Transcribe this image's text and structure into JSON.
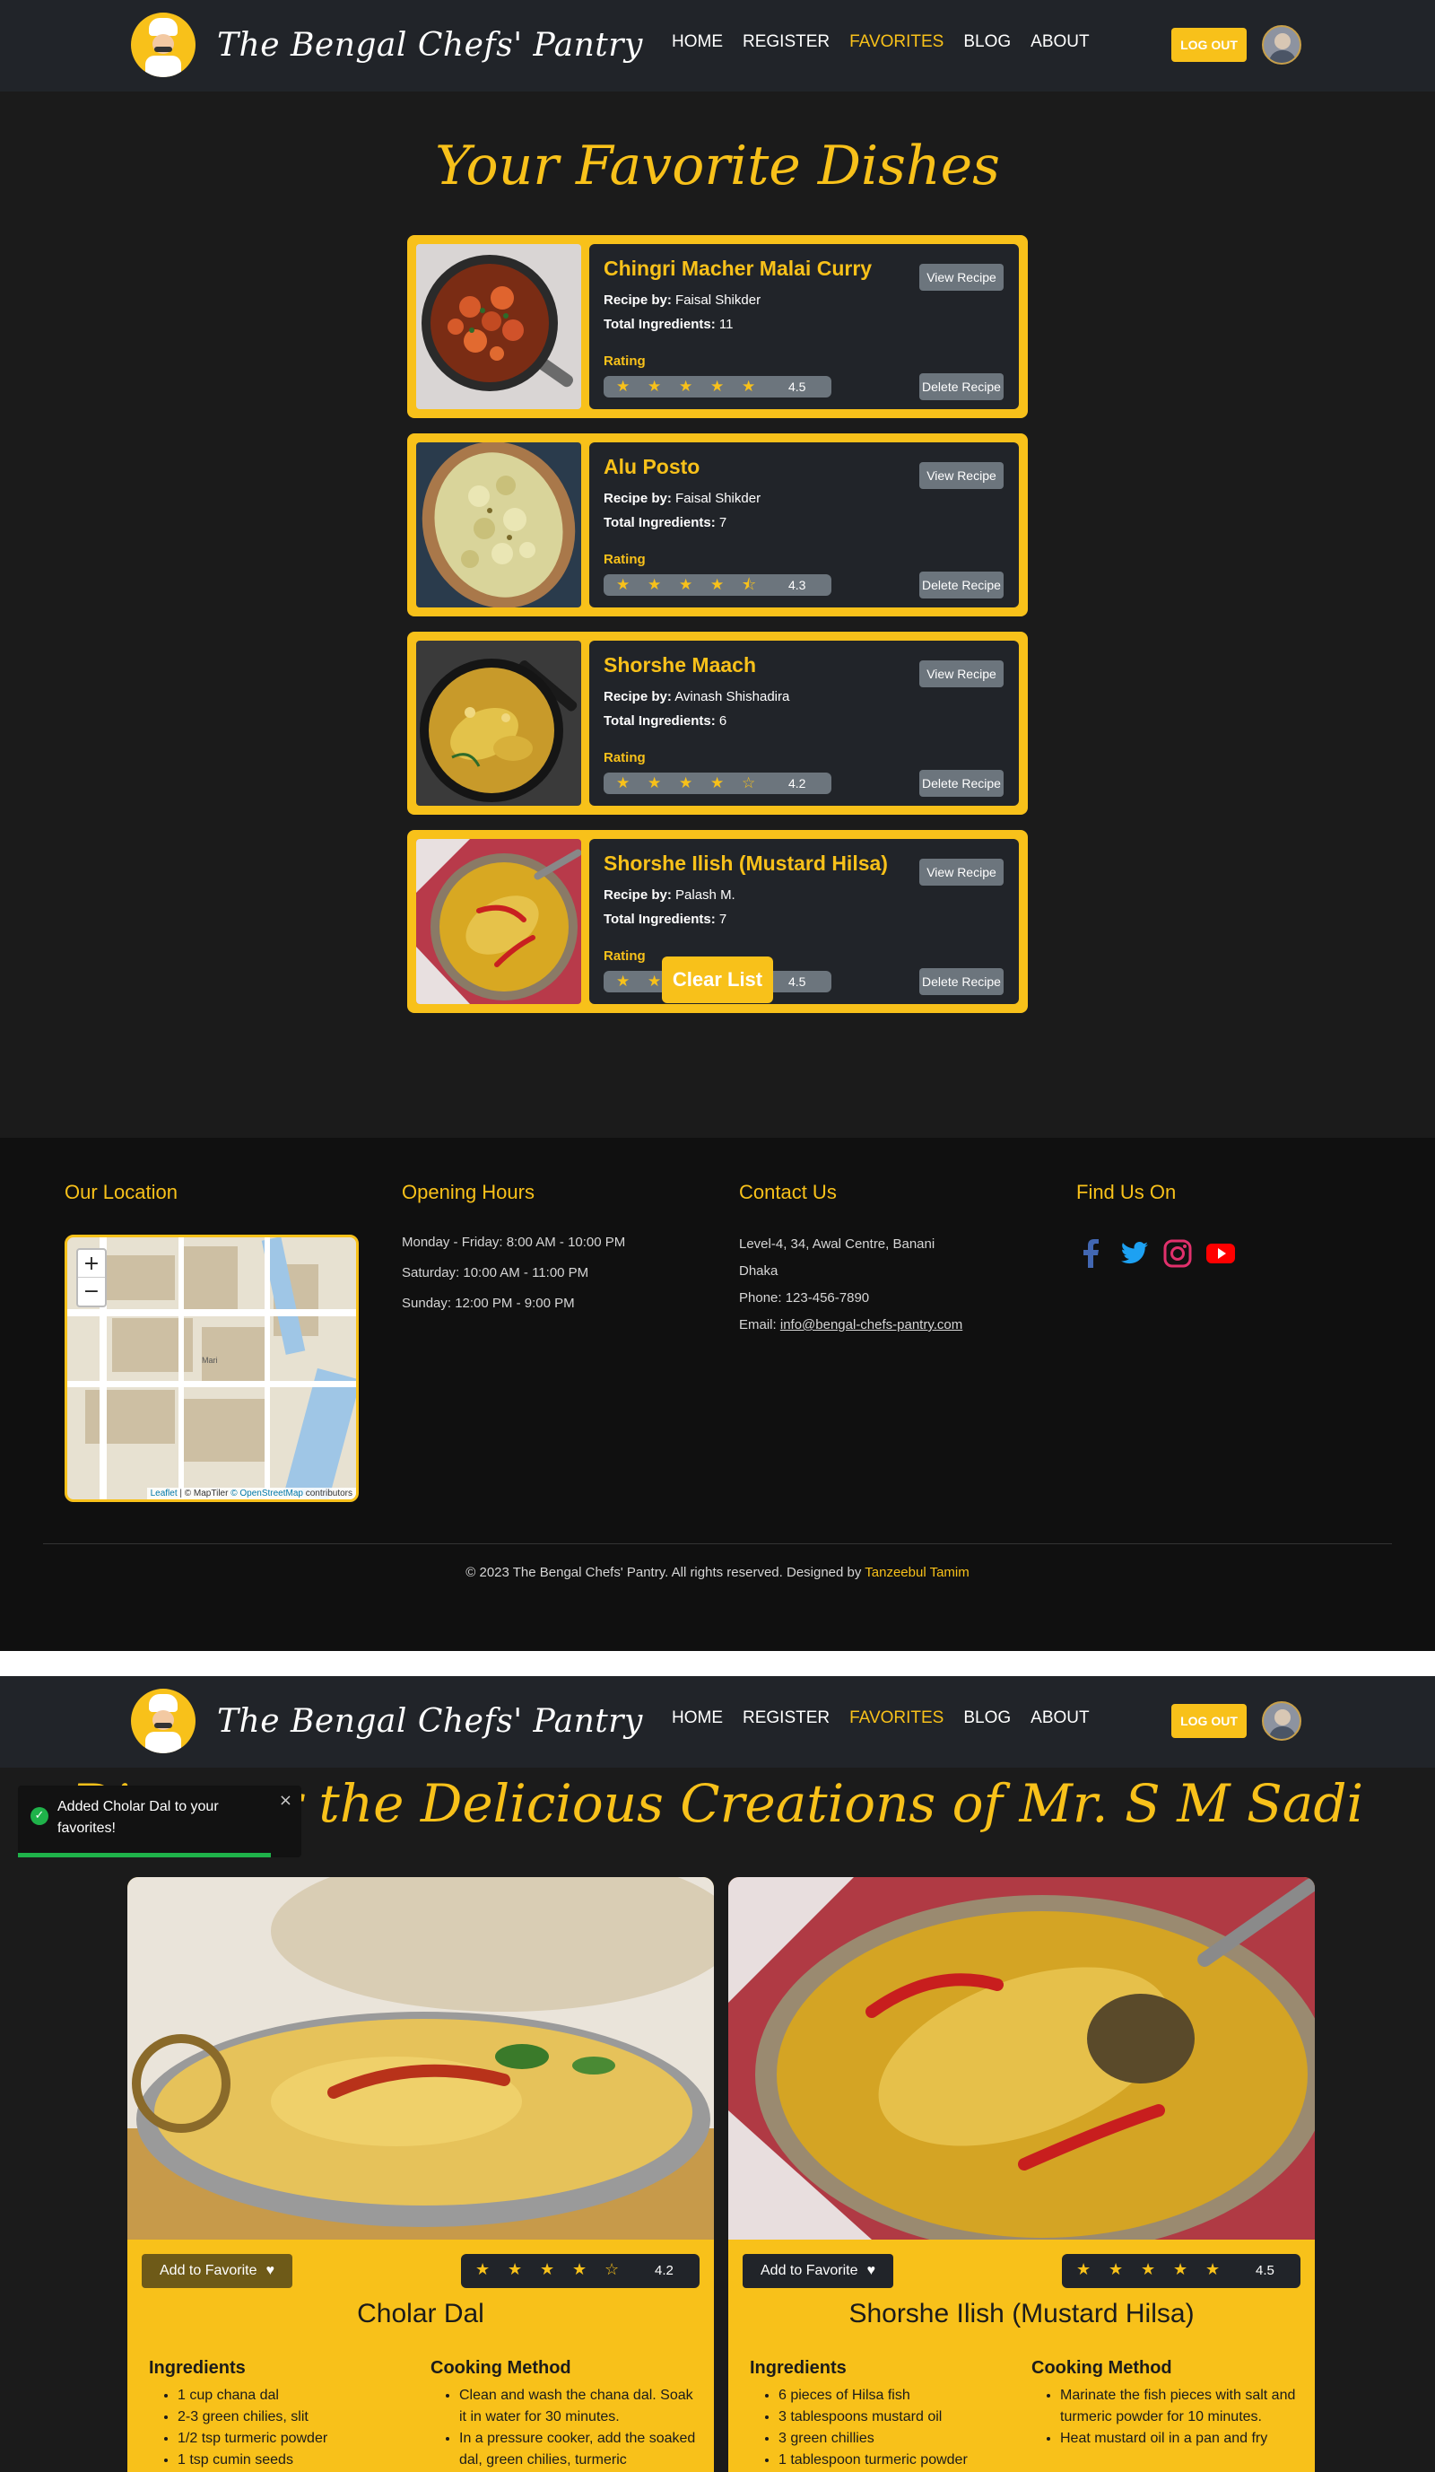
{
  "header": {
    "brand": "The Bengal Chefs' Pantry",
    "nav": [
      "HOME",
      "REGISTER",
      "FAVORITES",
      "BLOG",
      "ABOUT"
    ],
    "active_nav": "FAVORITES",
    "logout_label": "LOG OUT"
  },
  "favorites": {
    "title": "Your Favorite Dishes",
    "recipe_by_label": "Recipe by:",
    "total_ingredients_label": "Total Ingredients:",
    "rating_label": "Rating",
    "view_label": "View Recipe",
    "delete_label": "Delete Recipe",
    "items": [
      {
        "name": "Chingri Macher Malai Curry",
        "chef": "Faisal Shikder",
        "ingredients": "11",
        "rating": "4.5"
      },
      {
        "name": "Alu Posto",
        "chef": "Faisal Shikder",
        "ingredients": "7",
        "rating": "4.3"
      },
      {
        "name": "Shorshe Maach",
        "chef": "Avinash Shishadira",
        "ingredients": "6",
        "rating": "4.2"
      },
      {
        "name": "Shorshe Ilish (Mustard Hilsa)",
        "chef": "Palash M.",
        "ingredients": "7",
        "rating": "4.5"
      }
    ],
    "clear_label": "Clear List"
  },
  "footer": {
    "location_title": "Our Location",
    "hours_title": "Opening Hours",
    "hours": [
      "Monday - Friday: 8:00 AM - 10:00 PM",
      "Saturday: 10:00 AM - 11:00 PM",
      "Sunday: 12:00 PM - 9:00 PM"
    ],
    "contact_title": "Contact Us",
    "contact": [
      "Level-4, 34, Awal Centre, Banani",
      "Dhaka",
      "Phone: 123-456-7890"
    ],
    "email_label": "Email:",
    "email": "info@bengal-chefs-pantry.com",
    "social_title": "Find Us On",
    "social_icons": [
      "facebook-icon",
      "twitter-icon",
      "instagram-icon",
      "youtube-icon"
    ],
    "map": {
      "zoom_in": "+",
      "zoom_out": "−",
      "leaflet": "Leaflet",
      "maptiler": "© MapTiler",
      "osm": "© OpenStreetMap",
      "contributors": "contributors",
      "place": "Mari"
    },
    "copyright": "© 2023 The Bengal Chefs' Pantry. All rights reserved. Designed by",
    "designer": "Tanzeebul Tamim"
  },
  "chef_page": {
    "title": "Discover the Delicious Creations of Mr. S M Sadi",
    "toast": "Added Cholar Dal to your favorites!",
    "add_favorite_label": "Add to Favorite",
    "ingredients_label": "Ingredients",
    "method_label": "Cooking Method",
    "recipes": [
      {
        "name": "Cholar Dal",
        "rating": "4.2",
        "ingredients": [
          "1 cup chana dal",
          "2-3 green chilies, slit",
          "1/2 tsp turmeric powder",
          "1 tsp cumin seeds"
        ],
        "method": [
          "Clean and wash the chana dal. Soak it in water for 30 minutes.",
          "In a pressure cooker, add the soaked dal, green chilies, turmeric"
        ]
      },
      {
        "name": "Shorshe Ilish (Mustard Hilsa)",
        "rating": "4.5",
        "ingredients": [
          "6 pieces of Hilsa fish",
          "3 tablespoons mustard oil",
          "3 green chillies",
          "1 tablespoon turmeric powder"
        ],
        "method": [
          "Marinate the fish pieces with salt and turmeric powder for 10 minutes.",
          "Heat mustard oil in a pan and fry"
        ]
      }
    ]
  },
  "colors": {
    "accent": "#f8c11a",
    "dark": "#212429",
    "page_bg": "#1b1b1b",
    "footer_bg": "#101010",
    "success": "#1fb24a"
  }
}
